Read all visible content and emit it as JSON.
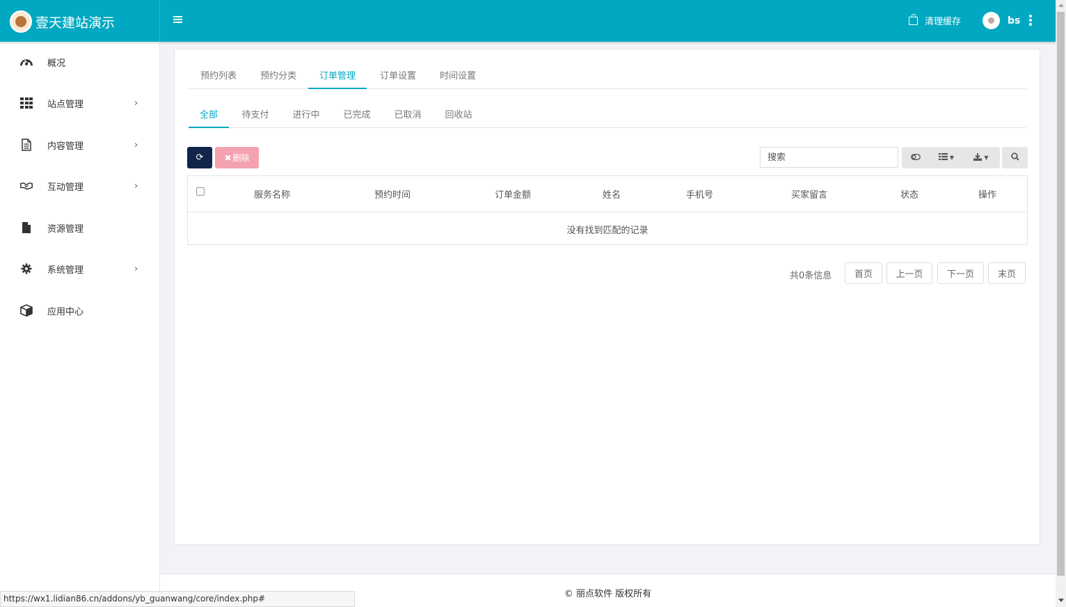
{
  "app": {
    "brand": "壹天建站演示"
  },
  "header": {
    "clear_cache": "清理缓存",
    "username": "bs"
  },
  "sidebar": {
    "items": [
      {
        "label": "概况",
        "icon": "dashboard-icon",
        "has_children": false
      },
      {
        "label": "站点管理",
        "icon": "grid-icon",
        "has_children": true
      },
      {
        "label": "内容管理",
        "icon": "document-icon",
        "has_children": true
      },
      {
        "label": "互动管理",
        "icon": "handshake-icon",
        "has_children": true
      },
      {
        "label": "资源管理",
        "icon": "file-icon",
        "has_children": false
      },
      {
        "label": "系统管理",
        "icon": "gear-icon",
        "has_children": true
      },
      {
        "label": "应用中心",
        "icon": "cube-icon",
        "has_children": false
      }
    ]
  },
  "tabs_primary": [
    {
      "label": "预约列表",
      "active": false
    },
    {
      "label": "预约分类",
      "active": false
    },
    {
      "label": "订单管理",
      "active": true
    },
    {
      "label": "订单设置",
      "active": false
    },
    {
      "label": "时间设置",
      "active": false
    }
  ],
  "tabs_status": [
    {
      "label": "全部",
      "active": true
    },
    {
      "label": "待支付",
      "active": false
    },
    {
      "label": "进行中",
      "active": false
    },
    {
      "label": "已完成",
      "active": false
    },
    {
      "label": "已取消",
      "active": false
    },
    {
      "label": "回收站",
      "active": false
    }
  ],
  "toolbar": {
    "delete_label": "删除",
    "search_placeholder": "搜索"
  },
  "table": {
    "columns": [
      "服务名称",
      "预约时间",
      "订单金额",
      "姓名",
      "手机号",
      "买家留言",
      "状态",
      "操作"
    ],
    "rows": [],
    "empty_text": "没有找到匹配的记录"
  },
  "pagination": {
    "info": "共0条信息",
    "first": "首页",
    "prev": "上一页",
    "next": "下一页",
    "last": "末页"
  },
  "footer": {
    "copyright": "© 丽点软件 版权所有"
  },
  "status_bar": {
    "url": "https://wx1.lidian86.cn/addons/yb_guanwang/core/index.php#"
  },
  "colors": {
    "primary": "#00a9c1",
    "refresh_button": "#11254a",
    "delete_button": "#f5a2b0"
  }
}
